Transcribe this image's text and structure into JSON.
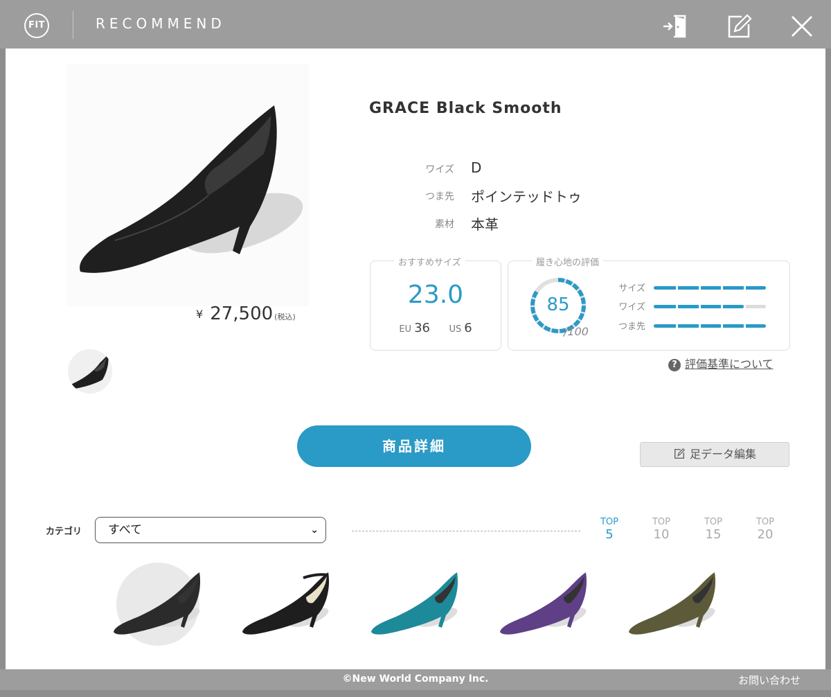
{
  "header": {
    "logo_text": "FIT",
    "title": "RECOMMEND",
    "icons": [
      "exit-icon",
      "edit-icon",
      "close-icon"
    ]
  },
  "product": {
    "name": "GRACE Black Smooth",
    "price_symbol": "¥",
    "price": "27,500",
    "tax_note": "(税込)",
    "specs": [
      {
        "label": "ワイズ",
        "value": "D"
      },
      {
        "label": "つま先",
        "value": "ポインテッドトゥ"
      },
      {
        "label": "素材",
        "value": "本革"
      }
    ]
  },
  "recommended_size": {
    "legend": "おすすめサイズ",
    "size": "23.0",
    "eu_label": "EU",
    "eu": "36",
    "us_label": "US",
    "us": "6"
  },
  "comfort": {
    "legend": "履き心地の評価",
    "score": "85",
    "score_max": "/100",
    "score_value": 85,
    "ratings": [
      {
        "label": "サイズ",
        "level": 1.0
      },
      {
        "label": "ワイズ",
        "level": 0.8
      },
      {
        "label": "つま先",
        "level": 1.0
      }
    ]
  },
  "criteria_link": "評価基準について",
  "detail_button": "商品詳細",
  "edit_foot_button": "足データ編集",
  "category": {
    "label": "カテゴリ",
    "selected": "すべて"
  },
  "top_tabs": [
    {
      "top": "TOP",
      "n": "5",
      "active": true
    },
    {
      "top": "TOP",
      "n": "10",
      "active": false
    },
    {
      "top": "TOP",
      "n": "15",
      "active": false
    },
    {
      "top": "TOP",
      "n": "20",
      "active": false
    }
  ],
  "recommendations": [
    {
      "color": "#2b2b2b",
      "selected": true
    },
    {
      "color": "#1e1e1e",
      "selected": false
    },
    {
      "color": "#1d8a9a",
      "selected": false
    },
    {
      "color": "#5f3f86",
      "selected": false
    },
    {
      "color": "#5d5a3a",
      "selected": false
    }
  ],
  "footer": {
    "copyright": "©New World Company Inc.",
    "contact": "お問い合わせ"
  },
  "colors": {
    "accent": "#2a9ac6",
    "header": "#9d9d9d"
  }
}
